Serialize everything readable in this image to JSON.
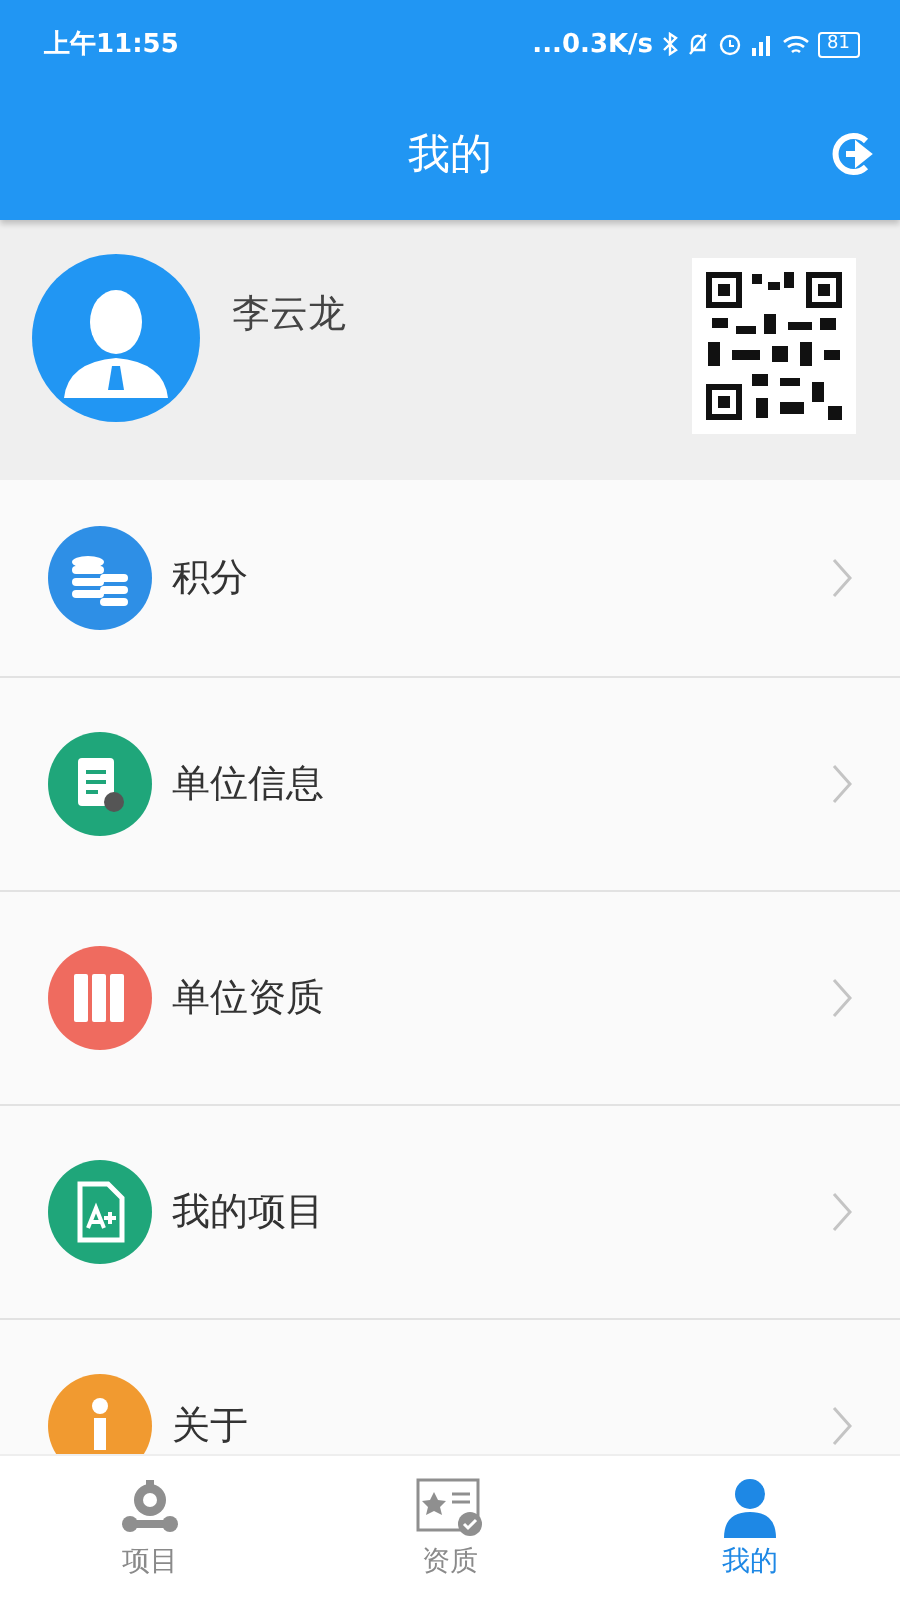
{
  "status_bar": {
    "time": "上午11:55",
    "speed": "...0.3K/s",
    "battery": "81"
  },
  "header": {
    "title": "我的"
  },
  "profile": {
    "name": "李云龙"
  },
  "menu": [
    {
      "label": "积分",
      "color": "#2e8fe6"
    },
    {
      "label": "单位信息",
      "color": "#1fa67a"
    },
    {
      "label": "单位资质",
      "color": "#ef6b5f"
    },
    {
      "label": "我的项目",
      "color": "#1fa67a"
    },
    {
      "label": "关于",
      "color": "#f19a30"
    }
  ],
  "tabs": [
    {
      "label": "项目",
      "selected": false
    },
    {
      "label": "资质",
      "selected": false
    },
    {
      "label": "我的",
      "selected": true
    }
  ]
}
